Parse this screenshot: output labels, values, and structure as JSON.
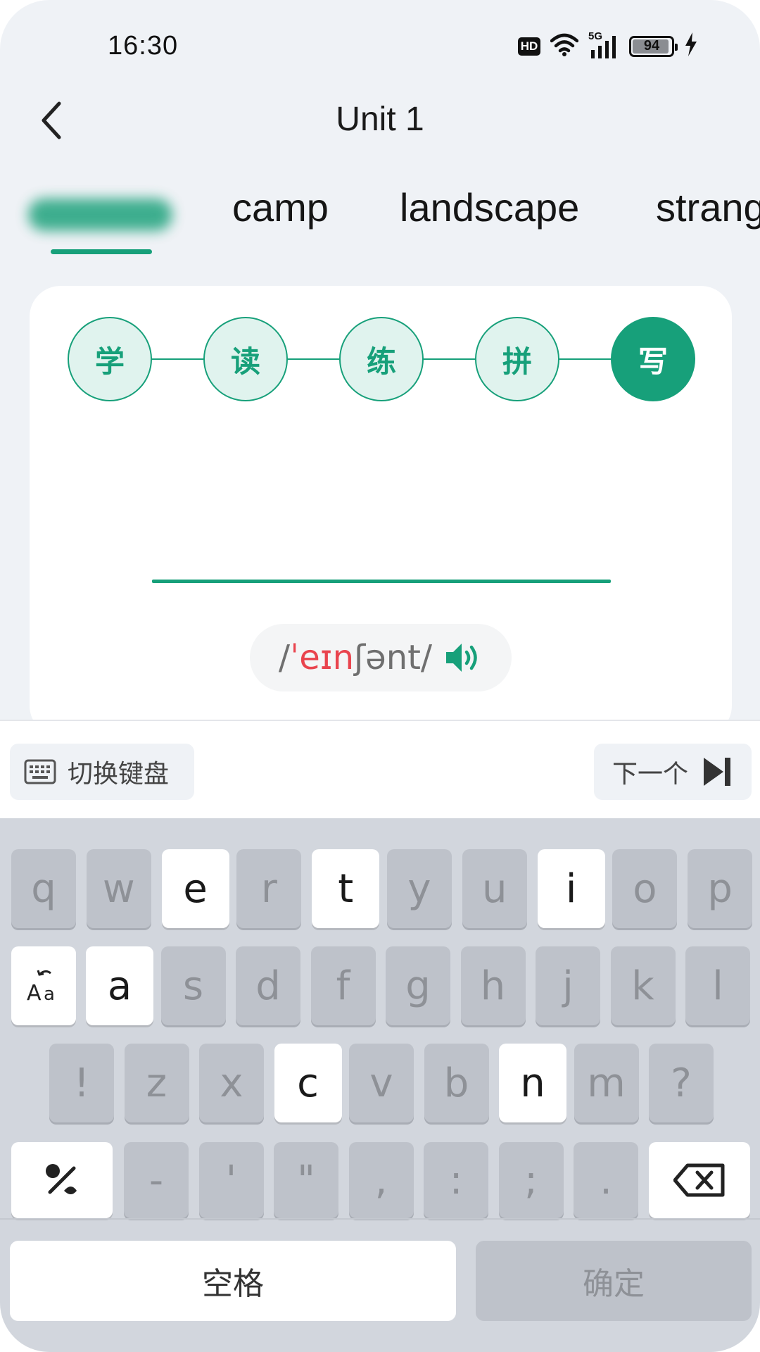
{
  "status_bar": {
    "time": "16:30",
    "hd": "HD",
    "network": "5G",
    "battery": "94",
    "icons": [
      "hd-icon",
      "wifi-icon",
      "signal-5g-icon",
      "battery-icon",
      "charging-bolt-icon"
    ]
  },
  "header": {
    "title": "Unit 1",
    "back_icon": "chevron-left-icon"
  },
  "tabs": [
    {
      "label": "",
      "active": true,
      "obscured": true
    },
    {
      "label": "camp",
      "active": false
    },
    {
      "label": "landscape",
      "active": false
    },
    {
      "label": "strang",
      "active": false
    }
  ],
  "steps": [
    {
      "label": "学",
      "active": false
    },
    {
      "label": "读",
      "active": false
    },
    {
      "label": "练",
      "active": false
    },
    {
      "label": "拼",
      "active": false
    },
    {
      "label": "写",
      "active": true
    }
  ],
  "phonetic": {
    "open": "/",
    "stress": "ˈeɪn",
    "rest": "ʃənt/",
    "icon": "speaker-icon"
  },
  "toolbar": {
    "switch_keyboard": "切换键盘",
    "next": "下一个"
  },
  "keyboard": {
    "row1": [
      {
        "k": "q",
        "on": false
      },
      {
        "k": "w",
        "on": false
      },
      {
        "k": "e",
        "on": true
      },
      {
        "k": "r",
        "on": false
      },
      {
        "k": "t",
        "on": true
      },
      {
        "k": "y",
        "on": false
      },
      {
        "k": "u",
        "on": false
      },
      {
        "k": "i",
        "on": true
      },
      {
        "k": "o",
        "on": false
      },
      {
        "k": "p",
        "on": false
      }
    ],
    "row2": [
      {
        "k": "a",
        "on": true
      },
      {
        "k": "s",
        "on": false
      },
      {
        "k": "d",
        "on": false
      },
      {
        "k": "f",
        "on": false
      },
      {
        "k": "g",
        "on": false
      },
      {
        "k": "h",
        "on": false
      },
      {
        "k": "j",
        "on": false
      },
      {
        "k": "k",
        "on": false
      },
      {
        "k": "l",
        "on": false
      }
    ],
    "row3": [
      {
        "k": "!",
        "on": false
      },
      {
        "k": "z",
        "on": false
      },
      {
        "k": "x",
        "on": false
      },
      {
        "k": "c",
        "on": true
      },
      {
        "k": "v",
        "on": false
      },
      {
        "k": "b",
        "on": false
      },
      {
        "k": "n",
        "on": true
      },
      {
        "k": "m",
        "on": false
      },
      {
        "k": "?",
        "on": false
      }
    ],
    "row4": [
      {
        "k": "-",
        "on": false
      },
      {
        "k": "'",
        "on": false
      },
      {
        "k": "\"",
        "on": false
      },
      {
        "k": ",",
        "on": false
      },
      {
        "k": ":",
        "on": false
      },
      {
        "k": ";",
        "on": false
      },
      {
        "k": ".",
        "on": false
      }
    ],
    "space": "空格",
    "confirm": "确定",
    "case_key_icon": "case-toggle-icon",
    "symbols_key_icon": "symbols-toggle-icon",
    "delete_key_icon": "backspace-icon"
  },
  "colors": {
    "accent": "#17a07a",
    "stress": "#e9444e",
    "background": "#eff2f6"
  }
}
